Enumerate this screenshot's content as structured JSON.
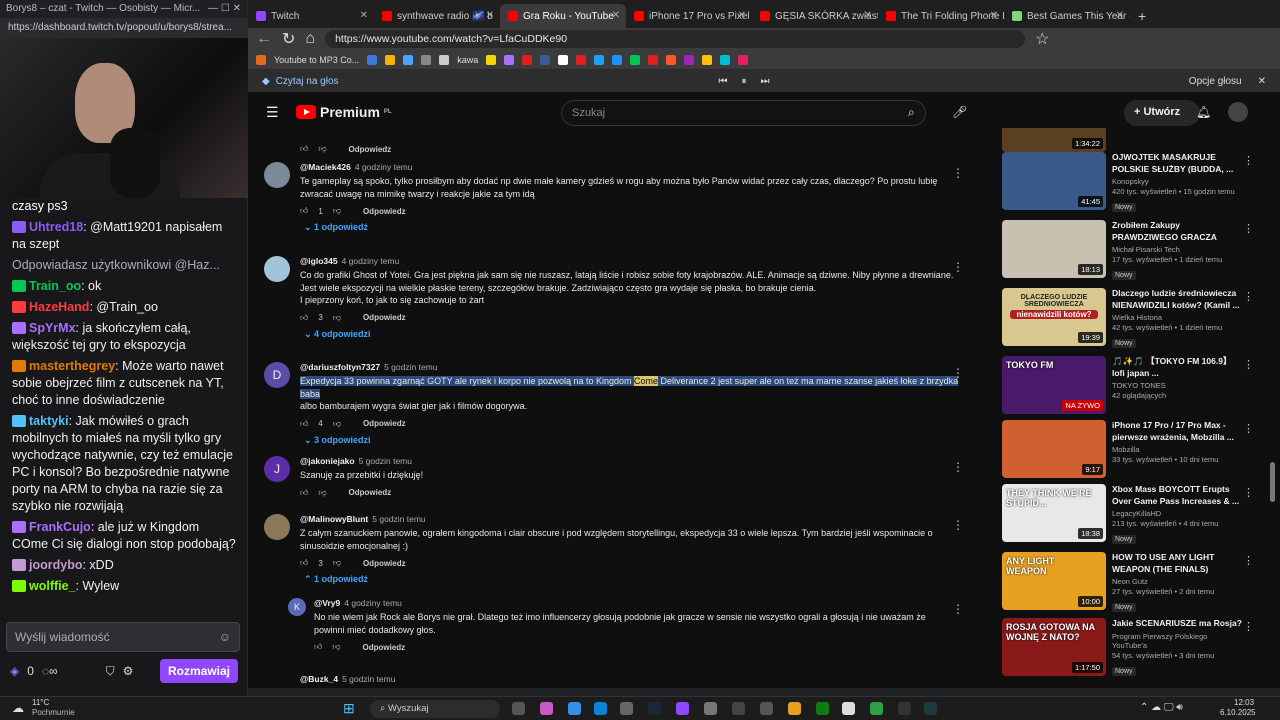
{
  "twitch": {
    "window_title": "Borys8 – czat - Twitch — Osobisty — Micr...",
    "url": "https://dashboard.twitch.tv/popout/u/borys8/strea...",
    "chat": [
      {
        "user": "",
        "text": "czasy ps3",
        "color": "#ffffff"
      },
      {
        "user": "Uhtred18",
        "text": ": @Matt19201 napisałem na szept",
        "color": "#8a5cf6"
      },
      {
        "user": "",
        "text": "Odpowiadasz użytkownikowi @Haz...",
        "color": "#adadb8"
      },
      {
        "user": "Train_oo",
        "text": ": ok",
        "color": "#00c853"
      },
      {
        "user": "HazeHand",
        "text": ": @Train_oo",
        "color": "#ff3b3b"
      },
      {
        "user": "SpYrMx",
        "text": ": ja skończyłem całą, większość tej gry to ekspozycja",
        "color": "#a970ff"
      },
      {
        "user": "masterthegrey",
        "text": ": Może warto nawet sobie obejrzeć film z cutscenek na YT, choć to inne doświadczenie",
        "color": "#e07b00"
      },
      {
        "user": "taktyki",
        "text": ": Jak mówiłeś o grach mobilnych to miałeś na myśli tylko gry wychodzące natywnie, czy też emulacje PC i konsol? Bo bezpośrednie natywne porty na ARM to chyba na razie się za szybko nie rozwijają",
        "color": "#4fc3f7"
      },
      {
        "user": "FrankCujo",
        "text": ": ale już w Kingdom COme Ci się dialogi non stop podobają?",
        "color": "#a970ff"
      },
      {
        "user": "joordybo",
        "text": ": xDD",
        "color": "#c39bd3"
      },
      {
        "user": "wolffie_",
        "text": ": Wylew",
        "color": "#7cfc00"
      }
    ],
    "input_placeholder": "Wyślij wiadomość",
    "points": "0",
    "chat_button": "Rozmawiaj"
  },
  "browser": {
    "tabs": [
      {
        "label": "Twitch",
        "color": "#9147ff"
      },
      {
        "label": "synthwave radio 🌌 b",
        "color": "#ff0000"
      },
      {
        "label": "Gra Roku - YouTube",
        "color": "#ff0000"
      },
      {
        "label": "iPhone 17 Pro vs Pixel 10",
        "color": "#ff0000"
      },
      {
        "label": "GĘSIA SKÓRKA zwiastun P",
        "color": "#ff0000"
      },
      {
        "label": "The Tri Folding Phone Imp",
        "color": "#ff0000"
      },
      {
        "label": "Best Games This Year - Me",
        "color": "#7ad97a"
      }
    ],
    "url": "https://www.youtube.com/watch?v=LfaCuDDKe90",
    "bookmarks": [
      "Youtube to MP3 Co...",
      "kawa"
    ],
    "read_aloud": "Czytaj na głos",
    "voice_options": "Opcje głosu"
  },
  "youtube": {
    "logo": "Premium",
    "logo_region": "PL",
    "search_placeholder": "Szukaj",
    "create": "Utwórz",
    "comments": [
      {
        "author": "@Maciek426",
        "time": "4 godziny temu",
        "text": "Te gameplay są spoko, tylko prosiłbym aby dodać np dwie małe kamery gdzieś w rogu aby można było Panów widać przez cały czas, dlaczego? Po prostu lubię zwracać uwagę na mimikę twarzy i reakcje jakie za tym idą",
        "likes": "1",
        "replies": "1 odpowiedź",
        "avatar": "#7a8a99"
      },
      {
        "author": "@iglo345",
        "time": "4 godziny temu",
        "text": "Co do grafiki Ghost of Yotei. Gra jest piękna jak sam się nie ruszasz, latają liście i robisz sobie foty krajobrazów. ALE. Animacje są dziwne. Niby płynne a drewniane. Jest wiele ekspozycji na wielkie płaskie tereny, szczegółów brakuje. Zadziwiająco często gra wydaje się płaska, bo brakuje cienia.\nI pieprzony koń, to jak to się zachowuje to żart",
        "likes": "3",
        "replies": "4 odpowiedzi",
        "avatar": "#a0c4d8"
      },
      {
        "author": "@dariuszfoltyn7327",
        "time": "5 godzin temu",
        "text_hl_a": "Expedycja 33 powinna zgarnąć GOTY  ale rynek i korpo nie pozwolą na to Kingdom ",
        "text_hl_b": "Come",
        "text_hl_c": " Deliverance 2 jest super ale on też ma marne szanse jakieś łoke z brzydka baba",
        "text_rest": "albo bamburajem wygra świat gier jak i filmów dogorywa.",
        "likes": "4",
        "replies": "3 odpowiedzi",
        "avatar": "#5c4ea8",
        "initial": "D"
      },
      {
        "author": "@jakoniejako",
        "time": "5 godzin temu",
        "text": "Szanuję  za przebitki i dziękuję!",
        "avatar": "#5c2da8",
        "initial": "J"
      },
      {
        "author": "@MalinowyBlunt",
        "time": "5 godzin temu",
        "text": "Z całym szanuckiem panowie, ograłem kingodoma i clair obscure i pod względem storytellingu, ekspedycja 33 o wiele lepsza. Tym bardziej jeśli wspominacie o sinusoidzie emocjonalnej :)",
        "likes": "3",
        "replies": "1 odpowiedź",
        "avatar": "#8a7a5a"
      },
      {
        "author": "@Vry9",
        "time": "4 godziny temu",
        "text": "No nie wiem jak Rock ale Borys nie grał. Dlatego też imo influencerzy głosują podobnie jak gracze w sensie nie wszystko ograli a głosują i nie uważam że powinni mieć dodadkowy głos.",
        "avatar": "#5a6ab8",
        "initial": "K"
      },
      {
        "author": "@Buzk_4",
        "time": "5 godzin temu"
      }
    ],
    "reply_label": "Odpowiedz",
    "sidebar": [
      {
        "title": "",
        "channel": "",
        "meta": "",
        "duration": "1:34:22",
        "thumb": "#5a4020"
      },
      {
        "title": "OJWOJTEK MASAKRUJE POLSKIE SŁUŻBY (BUDDA, ...",
        "channel": "Konopskyy",
        "meta": "420 tys. wyświetleń • 15 godzin temu",
        "duration": "41:45",
        "badge": "Nowy",
        "thumb": "#3a5a8a"
      },
      {
        "title": "Zrobiłem Zakupy PRAWDZIWEGO GRACZA",
        "channel": "Michał Pisarski Tech",
        "meta": "17 tys. wyświetleń • 1 dzień temu",
        "duration": "18:13",
        "badge": "Nowy",
        "thumb": "#c8c0b0"
      },
      {
        "title": "Dlaczego ludzie średniowiecza NIENAWIDZILI kotów? (Kamil ...",
        "channel": "Wielka Historia",
        "meta": "42 tys. wyświetleń • 1 dzień temu",
        "duration": "19:39",
        "badge": "Nowy",
        "thumb": "#d8c890",
        "overlay_a": "DLACZEGO LUDZIE ŚREDNIOWIECZA",
        "overlay_b": "nienawidzili kotów?"
      },
      {
        "title": "🎵✨🎵 【TOKYO FM 106.9】 lofi japan ...",
        "channel": "TOKYO TONES",
        "meta": "42 oglądających",
        "live": "NA ŻYWO",
        "thumb": "#4a1a6a",
        "overlay": "TOKYO FM"
      },
      {
        "title": "iPhone 17 Pro / 17 Pro Max - pierwsze wrażenia, Mobzilla ...",
        "channel": "Mobzilla",
        "meta": "33 tys. wyświetleń • 10 dni temu",
        "duration": "9:17",
        "thumb": "#d06030"
      },
      {
        "title": "Xbox Mass BOYCOTT Erupts Over Game Pass Increases & ...",
        "channel": "LegacyKillaHD",
        "meta": "213 tys. wyświetleń • 4 dni temu",
        "duration": "18:38",
        "badge": "Nowy",
        "thumb": "#e8e8e8",
        "overlay": "THEY THINK WE'RE STUPID..."
      },
      {
        "title": "HOW TO USE ANY LIGHT WEAPON (THE FINALS)",
        "channel": "Neon Gutz",
        "meta": "27 tys. wyświetleń • 2 dni temu",
        "duration": "10:00",
        "badge": "Nowy",
        "thumb": "#e8a020",
        "overlay": "ANY LIGHT WEAPON"
      },
      {
        "title": "Jakie SCENARIUSZE ma Rosja?",
        "channel": "Program Pierwszy Polskiego YouTube'a",
        "meta": "54 tys. wyświetleń • 3 dni temu",
        "duration": "1:17:50",
        "badge": "Nowy",
        "thumb": "#8a1a1a",
        "overlay": "ROSJA GOTOWA NA WOJNĘ Z NATO?"
      }
    ]
  },
  "taskbar": {
    "weather": "11°C",
    "weather_desc": "Pochmurnie",
    "search": "Wyszukaj",
    "time": "12:03",
    "date": "6.10.2025"
  }
}
